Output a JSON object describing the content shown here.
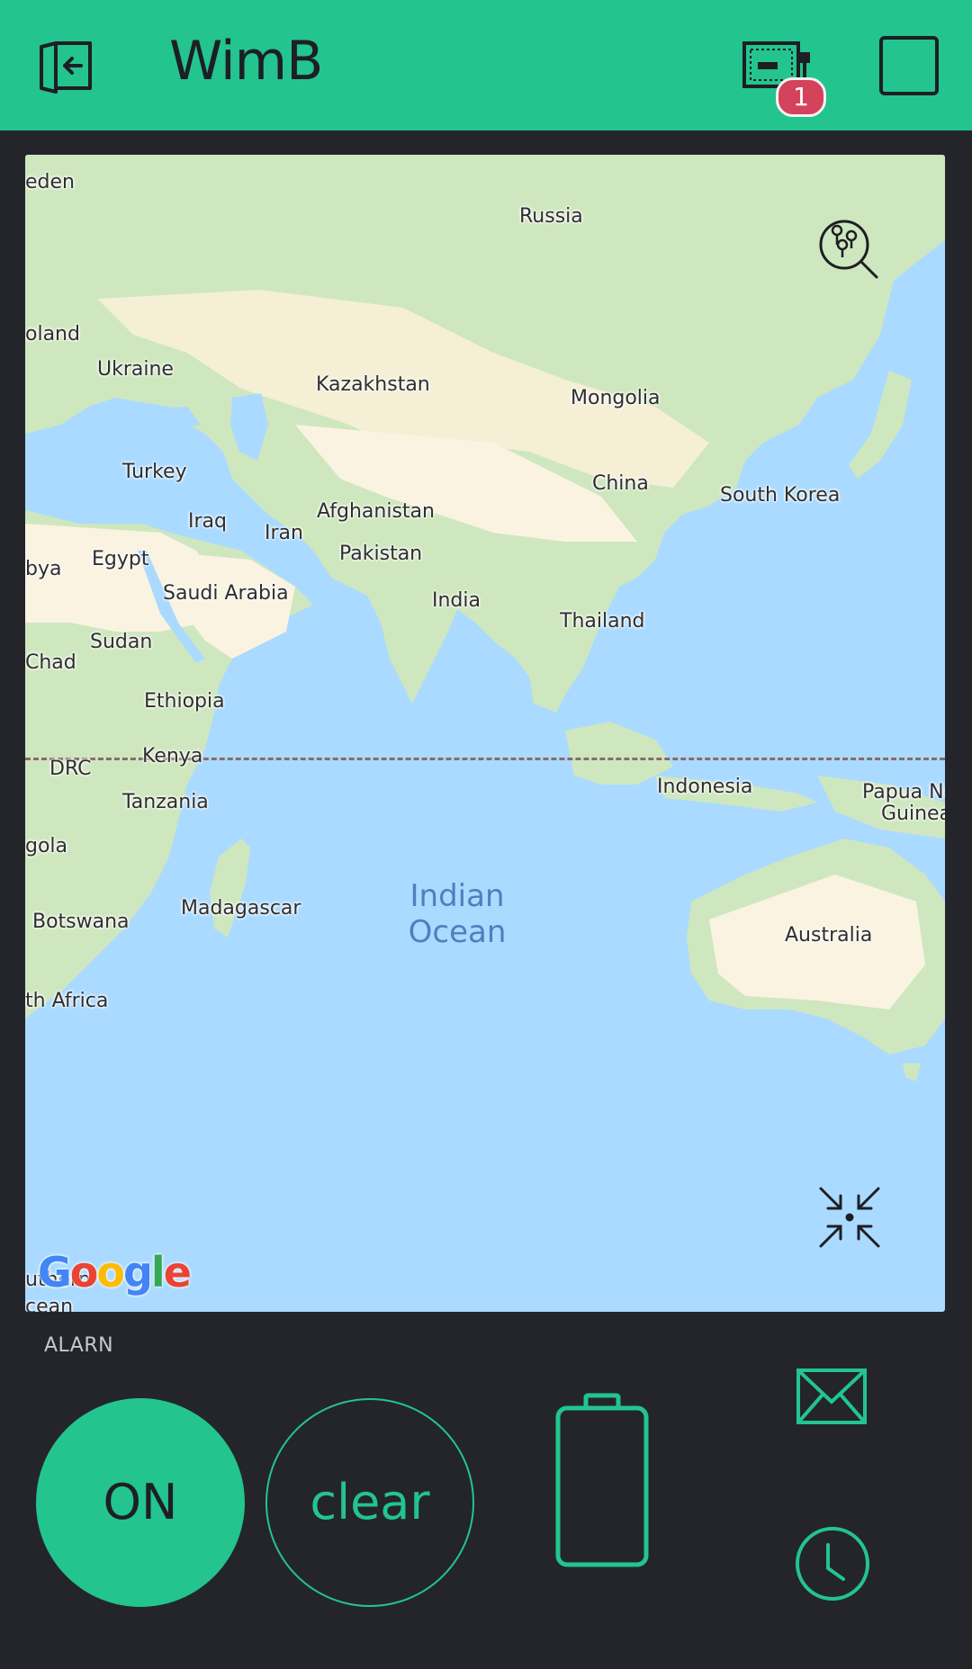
{
  "header": {
    "title": "WimB",
    "badge_count": "1",
    "background": "#23c48e"
  },
  "map": {
    "labels": {
      "sweden": "eden",
      "russia": "Russia",
      "poland": "oland",
      "ukraine": "Ukraine",
      "kazakhstan": "Kazakhstan",
      "mongolia": "Mongolia",
      "turkey": "Turkey",
      "china": "China",
      "south_korea": "South Korea",
      "iraq": "Iraq",
      "afghanistan": "Afghanistan",
      "iran": "Iran",
      "libya": "bya",
      "egypt": "Egypt",
      "pakistan": "Pakistan",
      "saudi_arabia": "Saudi Arabia",
      "india": "India",
      "thailand": "Thailand",
      "sudan": "Sudan",
      "chad": "Chad",
      "ethiopia": "Ethiopia",
      "kenya": "Kenya",
      "drc": "DRC",
      "indonesia": "Indonesia",
      "papua": "Papua Ne",
      "guinea": "Guinea",
      "tanzania": "Tanzania",
      "angola": "gola",
      "madagascar": "Madagascar",
      "botswana": "Botswana",
      "australia": "Australia",
      "south_africa": "th Africa",
      "southern_ocean": "uthern",
      "ocean_cut": "cean"
    },
    "ocean_line1": "Indian",
    "ocean_line2": "Ocean",
    "google": [
      "G",
      "o",
      "o",
      "g",
      "l",
      "e"
    ],
    "icons": {
      "search_pins": "map-search-icon",
      "collapse": "collapse-arrows-icon"
    }
  },
  "controls": {
    "alarm_label": "ALARN",
    "on_label": "ON",
    "clear_label": "clear",
    "accent": "#23c48e"
  }
}
